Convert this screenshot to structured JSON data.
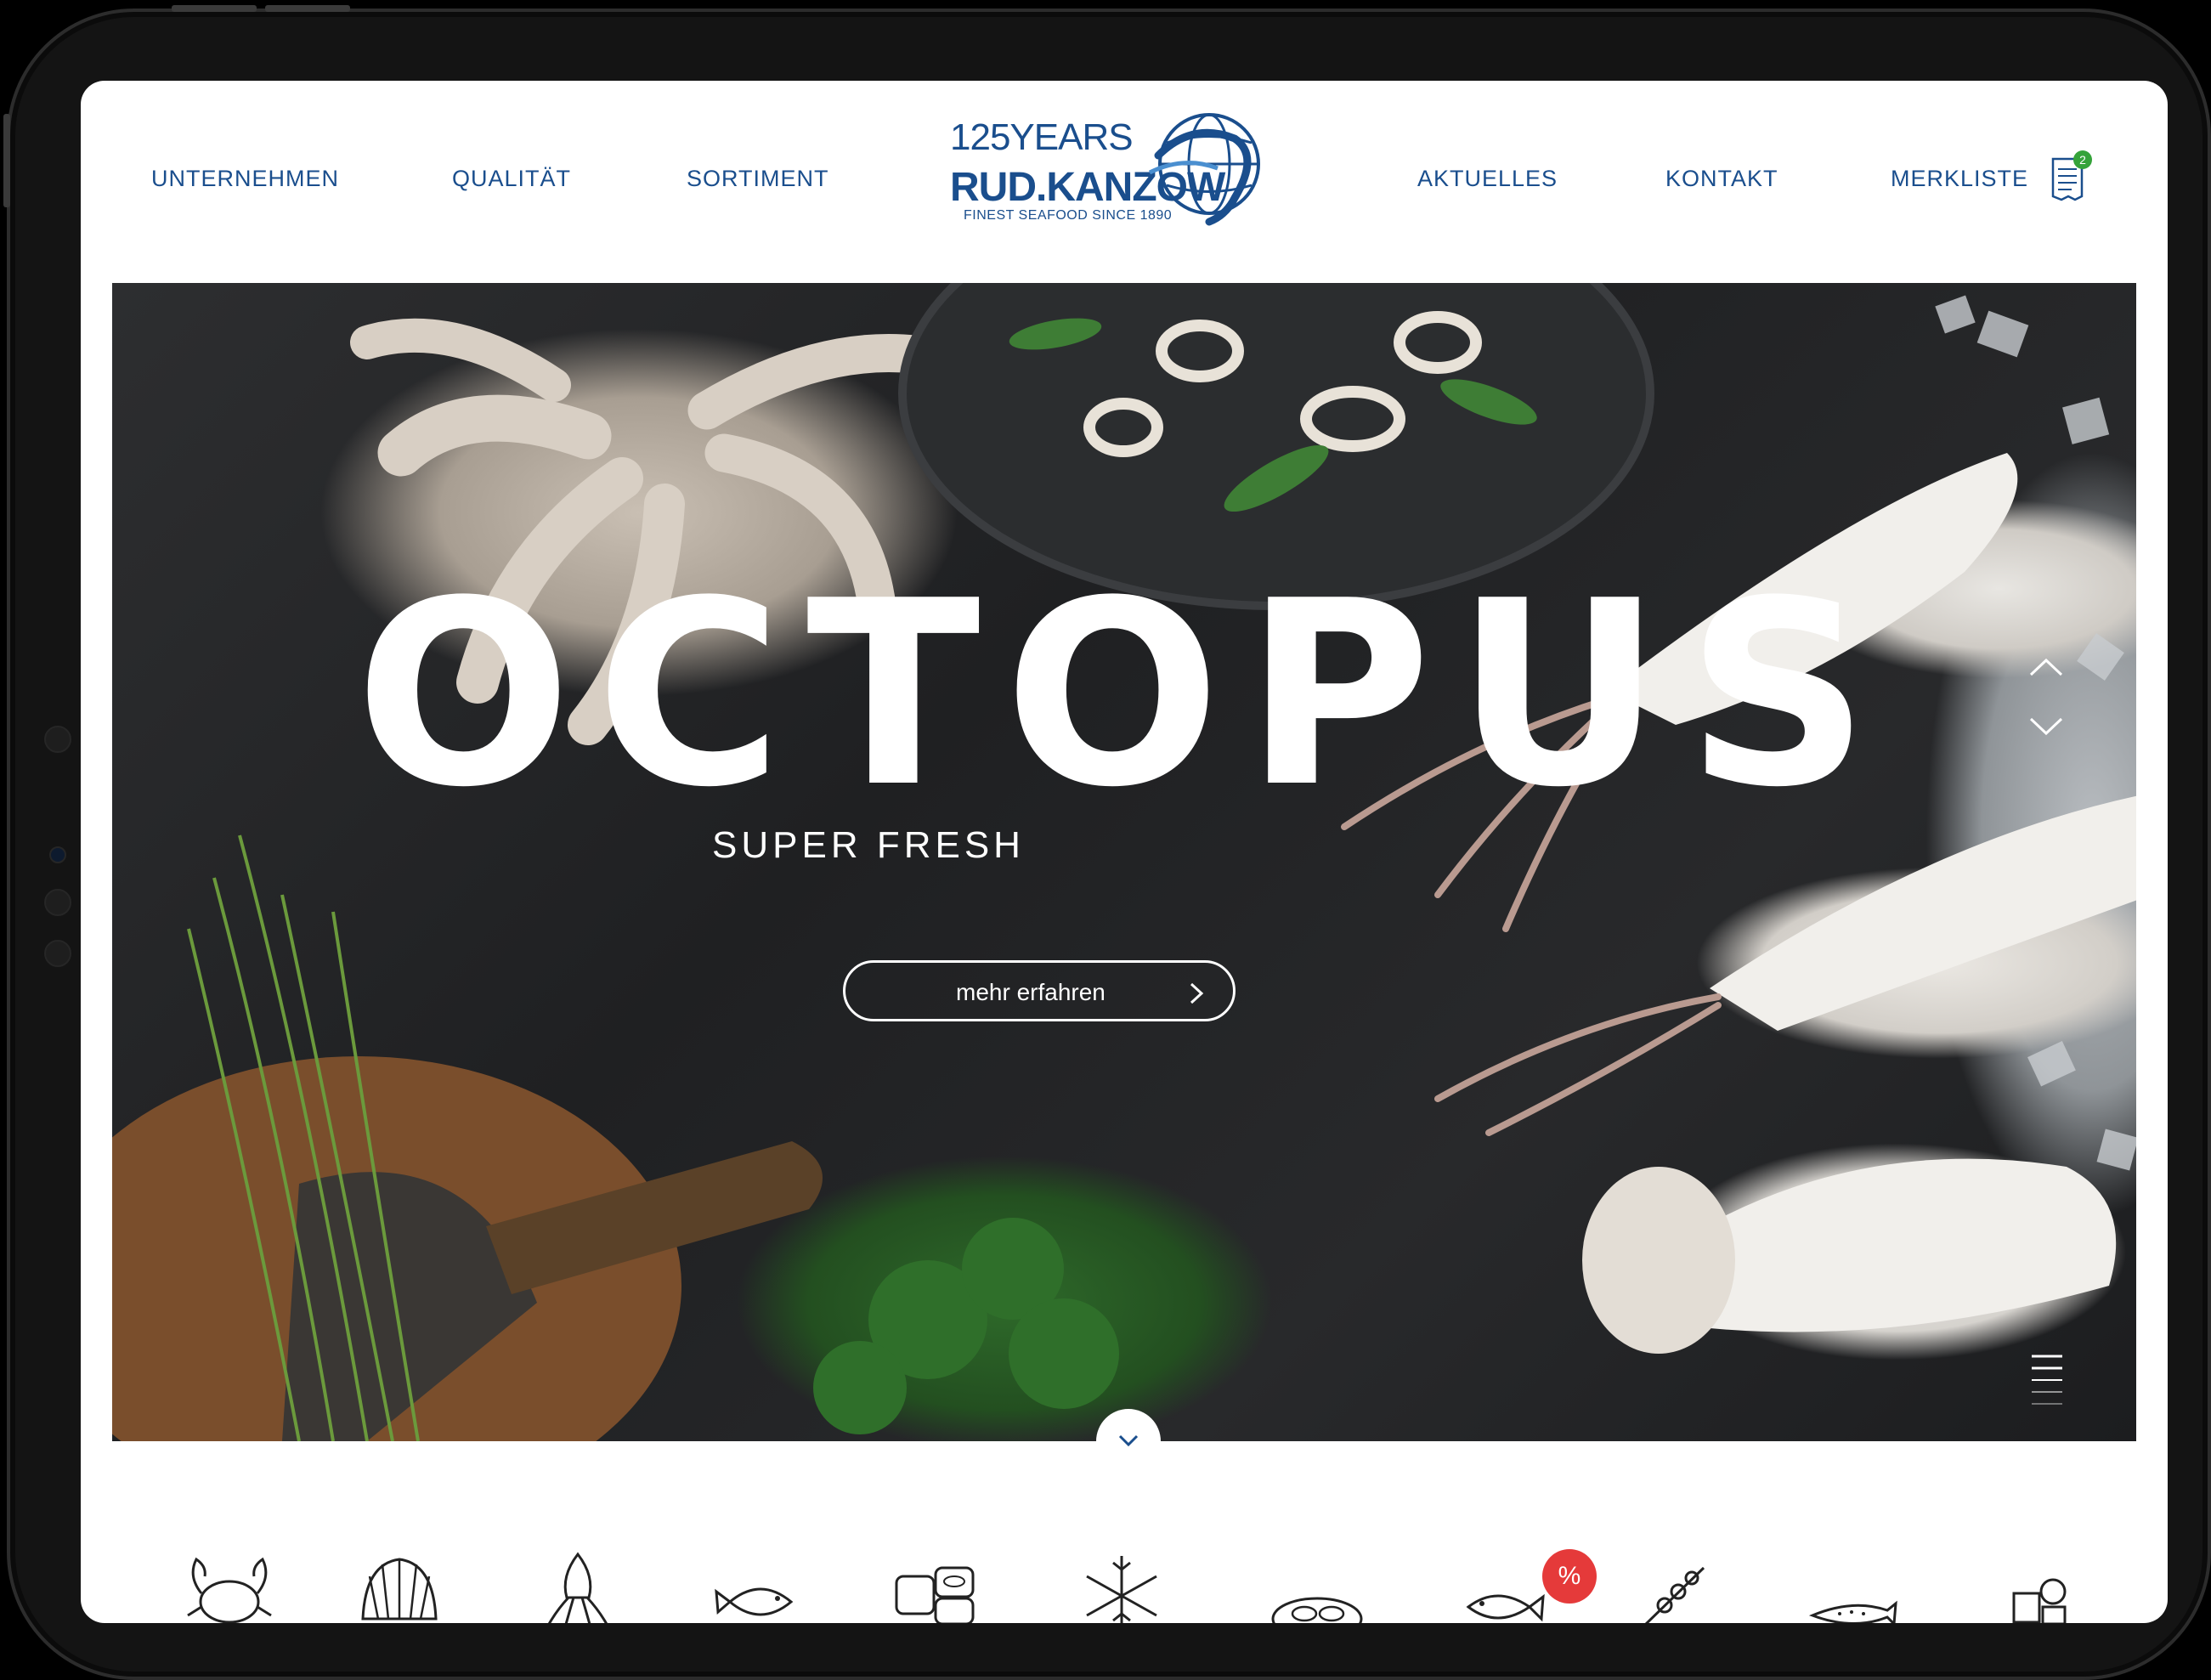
{
  "nav": {
    "left": [
      "UNTERNEHMEN",
      "QUALITÄT",
      "SORTIMENT"
    ],
    "right": [
      "AKTUELLES",
      "KONTAKT",
      "MERKLISTE"
    ]
  },
  "logo": {
    "years": "125YEARS",
    "name": "RUD.KANZOW",
    "tagline": "FINEST SEAFOOD SINCE 1890"
  },
  "merkliste_count": "2",
  "hero": {
    "title": "OCTOPUS",
    "subtitle": "SUPER FRESH",
    "button_label": "mehr erfahren"
  },
  "categories": [
    "crab-icon",
    "shell-icon",
    "squid-icon",
    "fish-icon",
    "sushi-icon",
    "snowflake-icon",
    "platter-icon",
    "sale-fish-icon",
    "skewer-icon",
    "salmon-icon",
    "misc-icon"
  ],
  "sale_badge": "%",
  "colors": {
    "brand_blue": "#1a4e8d",
    "badge_green": "#35a33a",
    "sale_red": "#e53a3a"
  }
}
